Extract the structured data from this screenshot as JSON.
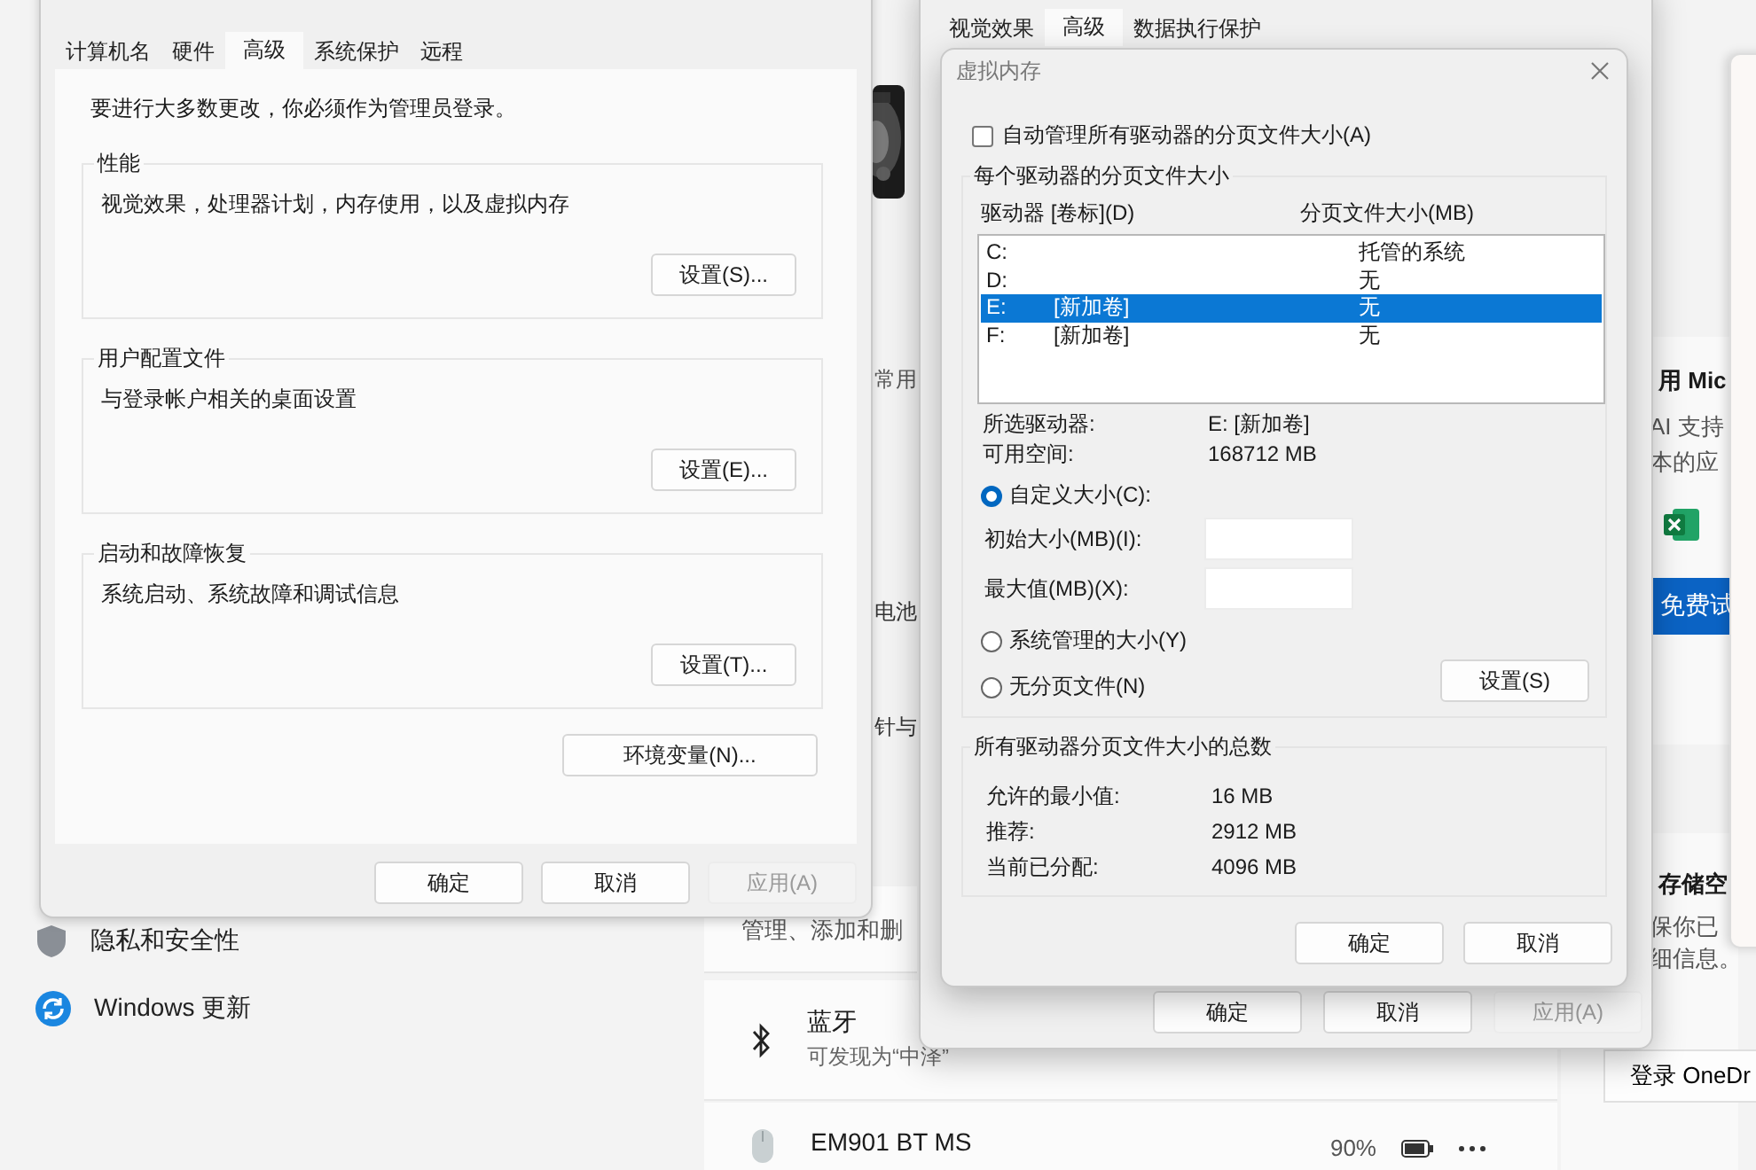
{
  "settings_app": {
    "sidebar_items": [
      {
        "kind": "shield",
        "label": "隐私和安全性",
        "selected": false
      },
      {
        "kind": "update",
        "label": "Windows 更新",
        "selected": false
      }
    ],
    "fragments": [
      "常用",
      "电池",
      "针与"
    ],
    "manage_text": "管理、添加和删",
    "devices": [
      {
        "kind": "bluetooth",
        "name": "蓝牙",
        "detail": "可发现为“中泽”"
      },
      {
        "kind": "mouse",
        "name": "EM901 BT MS",
        "battery": "90%"
      }
    ],
    "promo": {
      "title": "用 Mic",
      "lines": [
        "AI 支持",
        "本的应"
      ],
      "button": "免费试"
    },
    "storage": {
      "title": "存储空",
      "lines": [
        "保你已",
        "细信息。"
      ],
      "button": "登录 OneDr"
    }
  },
  "system_properties": {
    "tabs": [
      {
        "label": "计算机名",
        "selected": false
      },
      {
        "label": "硬件",
        "selected": false
      },
      {
        "label": "高级",
        "selected": true
      },
      {
        "label": "系统保护",
        "selected": false
      },
      {
        "label": "远程",
        "selected": false
      }
    ],
    "note": "要进行大多数更改，你必须作为管理员登录。",
    "groups": [
      {
        "title": "性能",
        "description": "视觉效果，处理器计划，内存使用，以及虚拟内存",
        "button": "设置(S)..."
      },
      {
        "title": "用户配置文件",
        "description": "与登录帐户相关的桌面设置",
        "button": "设置(E)..."
      },
      {
        "title": "启动和故障恢复",
        "description": "系统启动、系统故障和调试信息",
        "button": "设置(T)..."
      }
    ],
    "env_button": "环境变量(N)...",
    "buttons": [
      {
        "label": "确定",
        "disabled": false
      },
      {
        "label": "取消",
        "disabled": false
      },
      {
        "label": "应用(A)",
        "disabled": true
      }
    ]
  },
  "performance_options": {
    "tabs": [
      {
        "label": "视觉效果",
        "selected": false
      },
      {
        "label": "高级",
        "selected": true
      },
      {
        "label": "数据执行保护",
        "selected": false
      }
    ],
    "buttons": [
      {
        "label": "确定",
        "disabled": false
      },
      {
        "label": "取消",
        "disabled": false
      },
      {
        "label": "应用(A)",
        "disabled": true
      }
    ]
  },
  "virtual_memory": {
    "title": "虚拟内存",
    "auto_manage": {
      "label": "自动管理所有驱动器的分页文件大小(A)",
      "checked": false
    },
    "per_drive_title": "每个驱动器的分页文件大小",
    "columns": [
      "驱动器 [卷标](D)",
      "分页文件大小(MB)"
    ],
    "drives": [
      {
        "drive": "C:",
        "size": "托管的系统",
        "selected": false
      },
      {
        "drive": "D:",
        "size": "无",
        "selected": false
      },
      {
        "drive": "E:",
        "volume": "[新加卷]",
        "size": "无",
        "selected": true
      },
      {
        "drive": "F:",
        "volume": "[新加卷]",
        "size": "无",
        "selected": false
      }
    ],
    "info": [
      {
        "label": "所选驱动器:",
        "value": "E:  [新加卷]"
      },
      {
        "label": "可用空间:",
        "value": "168712 MB"
      }
    ],
    "size_options": [
      {
        "label": "自定义大小(C):",
        "selected": true
      },
      {
        "label": "系统管理的大小(Y)",
        "selected": false
      },
      {
        "label": "无分页文件(N)",
        "selected": false
      }
    ],
    "fields": [
      {
        "label": "初始大小(MB)(I):"
      },
      {
        "label": "最大值(MB)(X):"
      }
    ],
    "set_button": "设置(S)",
    "totals_title": "所有驱动器分页文件大小的总数",
    "totals": [
      {
        "label": "允许的最小值:",
        "value": "16 MB"
      },
      {
        "label": "推荐:",
        "value": "2912 MB"
      },
      {
        "label": "当前已分配:",
        "value": "4096 MB"
      }
    ],
    "buttons": [
      "确定",
      "取消"
    ]
  }
}
